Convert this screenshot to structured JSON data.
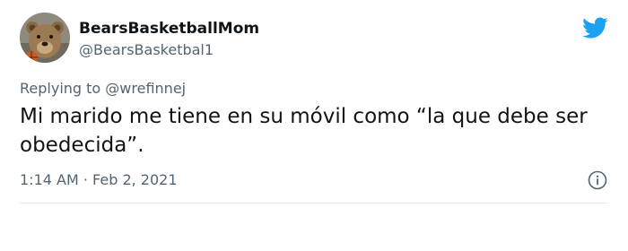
{
  "author": {
    "display_name": "BearsBasketballMom",
    "handle": "@BearsBasketbal1",
    "avatar_icon": "bear-avatar-icon"
  },
  "platform_icon": "twitter-bird-icon",
  "reply": {
    "prefix": "Replying to",
    "mention": "@wrefinnej"
  },
  "tweet": {
    "text": "Mi marido me tiene en su móvil como “la que debe ser obedecida”.",
    "timestamp": "1:14 AM · Feb 2, 2021"
  },
  "info_icon": "info-icon",
  "colors": {
    "brand_blue": "#1da1f2",
    "text_primary": "#0f1419",
    "text_secondary": "#536471"
  }
}
